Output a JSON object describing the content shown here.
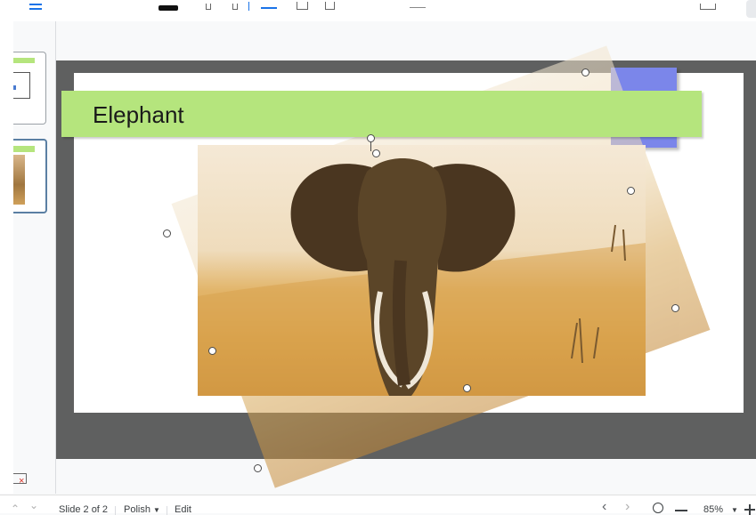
{
  "slide": {
    "title": "Elephant"
  },
  "status": {
    "slide_counter": "Slide 2 of 2",
    "language": "Polish",
    "edit": "Edit",
    "zoom": "85%"
  },
  "icons": [
    "chevron-up-icon",
    "chevron-down-icon",
    "caret-down-icon",
    "chevron-left-icon",
    "chevron-right-icon",
    "zoom-out-icon",
    "zoom-in-icon",
    "search-icon",
    "notes-icon"
  ],
  "colors": {
    "title_bar": "#b5e57d",
    "blue_shape": "#7b86ea",
    "selection_thumb_border": "#5a7fa3"
  }
}
